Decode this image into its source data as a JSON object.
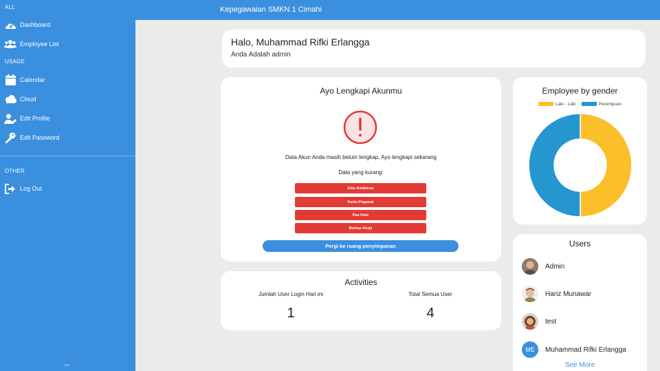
{
  "topbar": {
    "title": "Kepegawaian SMKN 1 Cimahi"
  },
  "sidebar": {
    "section_all": "ALL",
    "section_usage": "USAGE",
    "section_other": "OTHER",
    "items": [
      {
        "label": "Dashboard",
        "icon": "dashboard-icon"
      },
      {
        "label": "Employee List",
        "icon": "users-icon"
      },
      {
        "label": "Calendar",
        "icon": "calendar-icon"
      },
      {
        "label": "Cloud",
        "icon": "cloud-icon"
      },
      {
        "label": "Edit Profile",
        "icon": "user-edit-icon"
      },
      {
        "label": "Edit Password",
        "icon": "key-icon"
      },
      {
        "label": "Log Out",
        "icon": "logout-icon"
      }
    ],
    "resize_glyph": "↔"
  },
  "greeting": {
    "name": "Halo, Muhammad Rifki Erlangga",
    "role": "Anda Adalah admin"
  },
  "account": {
    "title": "Ayo Lengkapi Akunmu",
    "message": "Data Akun Anda masih belum lengkap, Ayo lengkapi sekarang",
    "missing_label": "Data yang kurang:",
    "missing": [
      "Akte Kelahiran",
      "Kartu Pegawai",
      "Pas Foto",
      "Berkas Kerja"
    ],
    "button": "Pergi ke ruang penyimpanan"
  },
  "activities": {
    "title": "Activities",
    "login_label": "Jumlah User Login Hari ini",
    "login_value": "1",
    "total_label": "Total Semua User",
    "total_value": "4"
  },
  "gender_chart": {
    "title": "Employee by gender",
    "legend": [
      "Laki - Laki",
      "Perempuan"
    ]
  },
  "chart_data": {
    "type": "pie",
    "title": "Employee by gender",
    "categories": [
      "Laki - Laki",
      "Perempuan"
    ],
    "values": [
      2,
      2
    ],
    "colors": [
      "#fbbf2a",
      "#2596cf"
    ]
  },
  "users": {
    "title": "Users",
    "list": [
      {
        "name": "Admin",
        "initials": ""
      },
      {
        "name": "Hariz Munawar",
        "initials": ""
      },
      {
        "name": "test",
        "initials": ""
      },
      {
        "name": "Muhammad Rifki Erlangga",
        "initials": "ME"
      }
    ],
    "see_more": "See More"
  },
  "colors": {
    "accent": "#3a8fdf",
    "danger": "#e23a34"
  }
}
